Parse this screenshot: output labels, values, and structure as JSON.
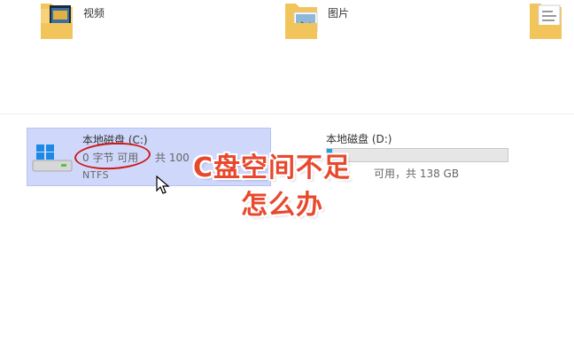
{
  "folders": [
    {
      "label": "视频",
      "icon": "video-folder-icon"
    },
    {
      "label": "图片",
      "icon": "pictures-folder-icon"
    },
    {
      "label": "",
      "icon": "documents-folder-icon"
    }
  ],
  "drives": {
    "c": {
      "name": "本地磁盘 (C:)",
      "free_text": "0 字节 可用",
      "total_text": "共 100",
      "filesystem": "NTFS",
      "icon": "windows-drive-icon"
    },
    "d": {
      "name": "本地磁盘 (D:)",
      "usage_text": "可用，共 138 GB",
      "used_fraction": 0.03
    }
  },
  "overlay": {
    "line1": "C盘空间不足",
    "line2": "怎么办"
  },
  "colors": {
    "selection_bg": "#cfd8fb",
    "annotation": "#d01818",
    "overlay_text": "#e8492e",
    "bar_fill": "#26a0da"
  }
}
